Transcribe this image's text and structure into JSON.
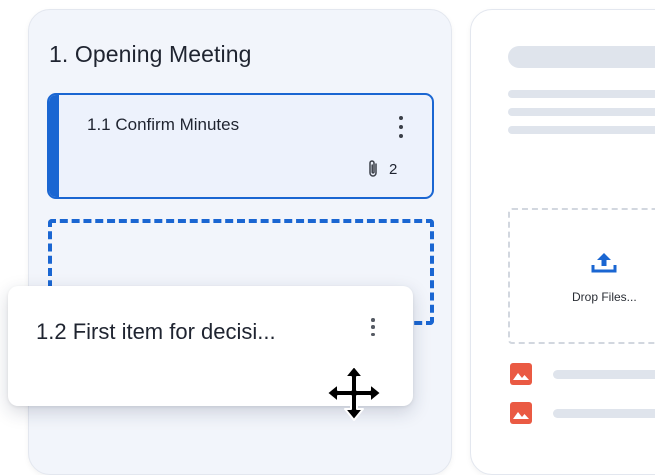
{
  "agenda": {
    "section_title": "1.  Opening Meeting",
    "items": [
      {
        "label": "1.1  Confirm Minutes",
        "attachments": "2"
      }
    ]
  },
  "dragged_item": {
    "label": "1.2  First item for decisi..."
  },
  "documents": {
    "drop_label": "Drop Files..."
  },
  "colors": {
    "accent": "#1a66d2",
    "image_icon": "#ea5a43",
    "panel_bg": "#f2f5fb"
  },
  "icons": [
    "kebab-menu-icon",
    "paperclip-icon",
    "move-cursor-icon",
    "upload-icon",
    "image-file-icon"
  ]
}
